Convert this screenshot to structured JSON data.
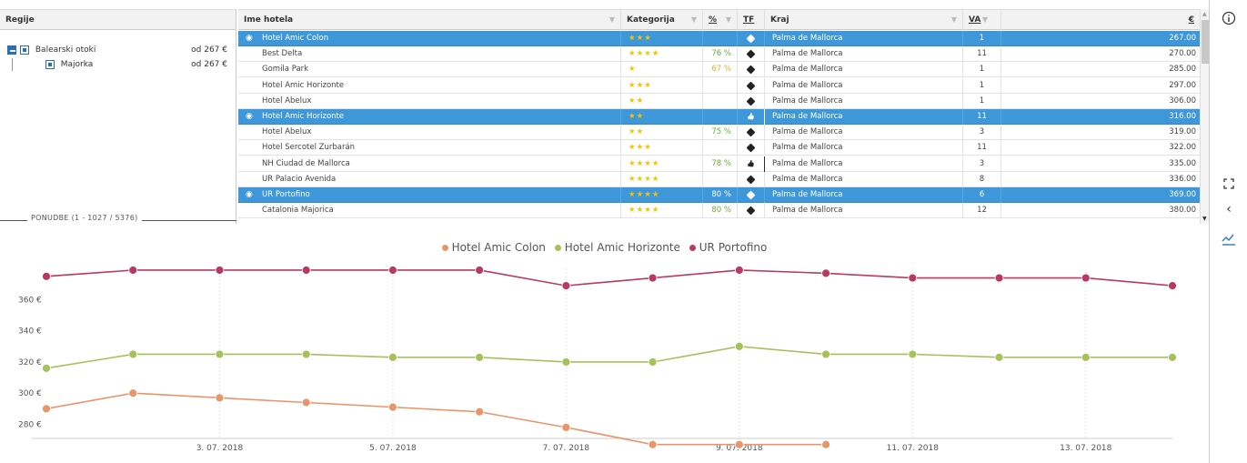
{
  "regions": {
    "header": "Regije",
    "items": [
      {
        "label": "Balearski otoki",
        "price": "od 267 €"
      },
      {
        "label": "Majorka",
        "price": "od 267 €"
      }
    ],
    "offers_label": "PONUDBE (1 - 1027 / 5376)"
  },
  "table": {
    "columns": {
      "name": "Ime hotela",
      "category": "Kategorija",
      "percent": "%",
      "tf": "TF",
      "location": "Kraj",
      "va": "VA",
      "price": "€"
    },
    "rows": [
      {
        "name": "Hotel Amic Colon",
        "stars": "★★★",
        "pct": "",
        "tf": "tag",
        "location": "Palma de Mallorca",
        "va": "1",
        "price": "267.00",
        "selected": true
      },
      {
        "name": "Best Delta",
        "stars": "★★★★",
        "pct": "76 %",
        "tf": "tag",
        "location": "Palma de Mallorca",
        "va": "11",
        "price": "270.00",
        "selected": false
      },
      {
        "name": "Gomila Park",
        "stars": "★",
        "pct": "67 %",
        "tf": "tag",
        "location": "Palma de Mallorca",
        "va": "1",
        "price": "285.00",
        "selected": false
      },
      {
        "name": "Hotel Amic Horizonte",
        "stars": "★★★",
        "pct": "",
        "tf": "tag",
        "location": "Palma de Mallorca",
        "va": "1",
        "price": "297.00",
        "selected": false
      },
      {
        "name": "Hotel Abelux",
        "stars": "★★",
        "pct": "",
        "tf": "tag",
        "location": "Palma de Mallorca",
        "va": "1",
        "price": "306.00",
        "selected": false
      },
      {
        "name": "Hotel Amic Horizonte",
        "stars": "★★",
        "pct": "",
        "tf": "thumb",
        "location": "Palma de Mallorca",
        "va": "11",
        "price": "316.00",
        "selected": true
      },
      {
        "name": "Hotel Abelux",
        "stars": "★★",
        "pct": "75 %",
        "tf": "tag",
        "location": "Palma de Mallorca",
        "va": "3",
        "price": "319.00",
        "selected": false
      },
      {
        "name": "Hotel Sercotel Zurbarán",
        "stars": "★★★",
        "pct": "",
        "tf": "tag",
        "location": "Palma de Mallorca",
        "va": "11",
        "price": "322.00",
        "selected": false
      },
      {
        "name": "NH Ciudad de Mallorca",
        "stars": "★★★★",
        "pct": "78 %",
        "tf": "thumb",
        "location": "Palma de Mallorca",
        "va": "3",
        "price": "335.00",
        "selected": false
      },
      {
        "name": "UR Palacio Avenida",
        "stars": "★★★★",
        "pct": "",
        "tf": "tag",
        "location": "Palma de Mallorca",
        "va": "8",
        "price": "336.00",
        "selected": false
      },
      {
        "name": "UR Portofino",
        "stars": "★★★★",
        "pct": "80 %",
        "tf": "tag",
        "location": "Palma de Mallorca",
        "va": "6",
        "price": "369.00",
        "selected": true
      },
      {
        "name": "Catalonia Majorica",
        "stars": "★★★★",
        "pct": "80 %",
        "tf": "tag",
        "location": "Palma de Mallorca",
        "va": "12",
        "price": "380.00",
        "selected": false
      }
    ]
  },
  "icons": {
    "info": "info-icon",
    "fullscreen": "fullscreen-icon",
    "collapse": "chevron-left-icon",
    "chart": "chart-icon"
  },
  "colors": {
    "selected_row": "#3d97d8",
    "series_amic_colon": "#e8956a",
    "series_amic_horizonte": "#a6c05a",
    "series_ur_portofino": "#b83a62"
  },
  "chart_data": {
    "type": "line",
    "title": "",
    "xlabel": "",
    "ylabel": "",
    "x": [
      "1.07",
      "2.07",
      "3.07",
      "4.07",
      "5.07",
      "6.07",
      "7.07",
      "8.07",
      "9.07",
      "10.07",
      "11.07",
      "12.07",
      "13.07",
      "14.07"
    ],
    "tick_labels": [
      "3. 07. 2018",
      "5. 07. 2018",
      "7. 07. 2018",
      "9. 07. 2018",
      "11. 07. 2018",
      "13. 07. 2018"
    ],
    "tick_index": [
      2,
      4,
      6,
      8,
      10,
      12
    ],
    "y_ticks": [
      "280 €",
      "300 €",
      "320 €",
      "340 €",
      "360 €"
    ],
    "y_tick_values": [
      280,
      300,
      320,
      340,
      360
    ],
    "ylim": [
      268,
      386
    ],
    "series": [
      {
        "name": "Hotel Amic Colon",
        "color": "#e8956a",
        "values": [
          290,
          300,
          297,
          294,
          291,
          288,
          278,
          267,
          267,
          267,
          null,
          null,
          null,
          null
        ]
      },
      {
        "name": "Hotel Amic Horizonte",
        "color": "#a6c05a",
        "values": [
          316,
          325,
          325,
          325,
          323,
          323,
          320,
          320,
          330,
          325,
          325,
          323,
          323,
          323
        ]
      },
      {
        "name": "UR Portofino",
        "color": "#b83a62",
        "values": [
          375,
          379,
          379,
          379,
          379,
          379,
          369,
          374,
          379,
          377,
          374,
          374,
          374,
          369
        ]
      }
    ],
    "legend_position": "top-center",
    "grid": "vertical-dashed"
  }
}
